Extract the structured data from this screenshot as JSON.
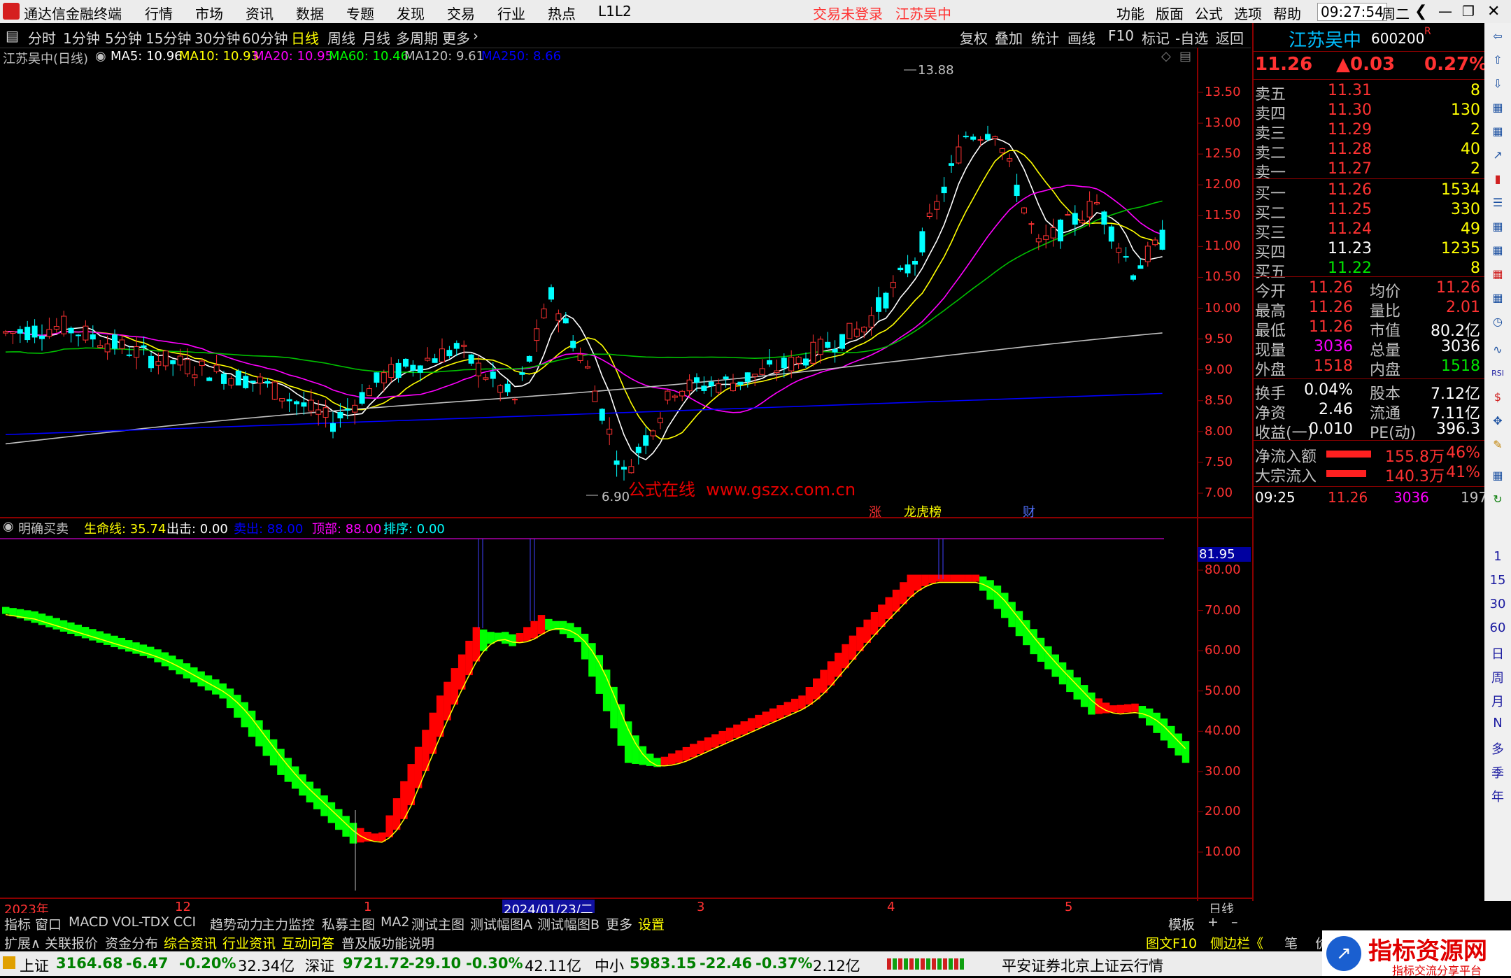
{
  "titlebar": {
    "app_name": "通达信金融终端",
    "menu": [
      "行情",
      "市场",
      "资讯",
      "数据",
      "专题",
      "发现",
      "交易",
      "行业",
      "热点",
      "L1L2"
    ],
    "login_status": "交易未登录",
    "stock_title": "江苏吴中",
    "right_menu": [
      "功能",
      "版面",
      "公式",
      "选项",
      "帮助"
    ],
    "time": "09:27:54",
    "weekday": "周二"
  },
  "periods": [
    "分时",
    "1分钟",
    "5分钟",
    "15分钟",
    "30分钟",
    "60分钟",
    "日线",
    "周线",
    "月线",
    "多周期",
    "更多"
  ],
  "selected_period": "日线",
  "right_buttons": [
    "复权",
    "叠加",
    "统计",
    "画线",
    "F10",
    "标记",
    "-自选",
    "返回"
  ],
  "ma_header": {
    "name": "江苏吴中(日线)",
    "ma5": "MA5: 10.96",
    "ma10": "MA10: 10.93",
    "ma20": "MA20: 10.95",
    "ma60": "MA60: 10.46",
    "ma120": "MA120: 9.61",
    "ma250": "MA250: 8.66"
  },
  "price_axis": [
    "13.50",
    "13.00",
    "12.50",
    "12.00",
    "11.50",
    "11.00",
    "10.50",
    "10.00",
    "9.50",
    "9.00",
    "8.50",
    "8.00",
    "7.50",
    "7.00"
  ],
  "annotations": {
    "high": "13.88",
    "low": "6.90",
    "watermark": "公式在线  www.gszx.com.cn",
    "tag1": "涨",
    "tag2": "龙虎榜",
    "tag3": "财"
  },
  "indicator_header": {
    "name": "明确买卖",
    "life": "生命线: 35.74",
    "exit": "出击: 0.00",
    "sell": "卖出: 88.00",
    "top": "顶部: 88.00",
    "order": "排序: 0.00"
  },
  "indicator_axis": [
    "80.00",
    "70.00",
    "60.00",
    "50.00",
    "40.00",
    "30.00",
    "20.00",
    "10.00"
  ],
  "indicator_level": "81.95",
  "date_axis": [
    "2023年",
    "12",
    "1",
    "2024/01/23/二",
    "3",
    "4",
    "5"
  ],
  "period_label": "日线",
  "tabs1": [
    "指标",
    "窗口",
    "MACD",
    "VOL-TDX",
    "CCI",
    "趋势动力",
    "主力监控",
    "私募主图",
    "MA2",
    "测试主图",
    "测试幅图A",
    "测试幅图B",
    "更多",
    "设置"
  ],
  "tabs1_right": "模板",
  "tabs2": [
    "扩展∧",
    "关联报价",
    "资金分布",
    "综合资讯",
    "行业资讯",
    "互动问答",
    "普及版功能说明"
  ],
  "tabs2_right": [
    "图文F10",
    "侧边栏《",
    "笔",
    "价"
  ],
  "quote": {
    "name": "江苏吴中",
    "code": "600200",
    "flag": "R",
    "price": "11.26",
    "change": "▲0.03",
    "pct": "0.27%",
    "asks": [
      {
        "label": "卖五",
        "price": "11.31",
        "vol": "8"
      },
      {
        "label": "卖四",
        "price": "11.30",
        "vol": "130"
      },
      {
        "label": "卖三",
        "price": "11.29",
        "vol": "2"
      },
      {
        "label": "卖二",
        "price": "11.28",
        "vol": "40"
      },
      {
        "label": "卖一",
        "price": "11.27",
        "vol": "2"
      }
    ],
    "bids": [
      {
        "label": "买一",
        "price": "11.26",
        "vol": "1534"
      },
      {
        "label": "买二",
        "price": "11.25",
        "vol": "330"
      },
      {
        "label": "买三",
        "price": "11.24",
        "vol": "49"
      },
      {
        "label": "买四",
        "price": "11.23",
        "vol": "1235"
      },
      {
        "label": "买五",
        "price": "11.22",
        "vol": "8"
      }
    ],
    "stats1": [
      {
        "l1": "今开",
        "v1": "11.26",
        "l2": "均价",
        "v2": "11.26"
      },
      {
        "l1": "最高",
        "v1": "11.26",
        "l2": "量比",
        "v2": "2.01"
      },
      {
        "l1": "最低",
        "v1": "11.26",
        "l2": "市值",
        "v2": "80.2亿"
      },
      {
        "l1": "现量",
        "v1": "3036",
        "l2": "总量",
        "v2": "3036"
      },
      {
        "l1": "外盘",
        "v1": "1518",
        "l2": "内盘",
        "v2": "1518"
      }
    ],
    "stats2": [
      {
        "l1": "换手",
        "v1": "0.04%",
        "l2": "股本",
        "v2": "7.12亿"
      },
      {
        "l1": "净资",
        "v1": "2.46",
        "l2": "流通",
        "v2": "7.11亿"
      },
      {
        "l1": "收益(一)",
        "v1": "0.010",
        "l2": "PE(动)",
        "v2": "396.3"
      }
    ],
    "flows": [
      {
        "label": "净流入额",
        "value": "155.8万",
        "pct": "46%",
        "fill": 0.46
      },
      {
        "label": "大宗流入",
        "value": "140.3万",
        "pct": "41%",
        "fill": 0.41
      }
    ],
    "tick": {
      "time": "09:25",
      "price": "11.26",
      "vol": "3036",
      "num": "197"
    }
  },
  "strip_labels": [
    "1",
    "15",
    "30",
    "60",
    "日",
    "周",
    "月",
    "N",
    "多",
    "季",
    "年"
  ],
  "status": {
    "sh_name": "上证",
    "sh_val": "3164.68",
    "sh_chg": "-6.47",
    "sh_pct": "-0.20%",
    "sh_amt": "32.34亿",
    "sz_name": "深证",
    "sz_val": "9721.72",
    "sz_chg": "-29.10",
    "sz_pct": "-0.30%",
    "sz_amt": "42.11亿",
    "zx_name": "中小",
    "zx_val": "5983.15",
    "zx_chg": "-22.46",
    "zx_pct": "-0.37%",
    "zx_amt": "2.12亿",
    "broker": "平安证券北京上证云行情",
    "brand": "指标资源网",
    "brand_sub": "指标交流分享平台"
  }
}
